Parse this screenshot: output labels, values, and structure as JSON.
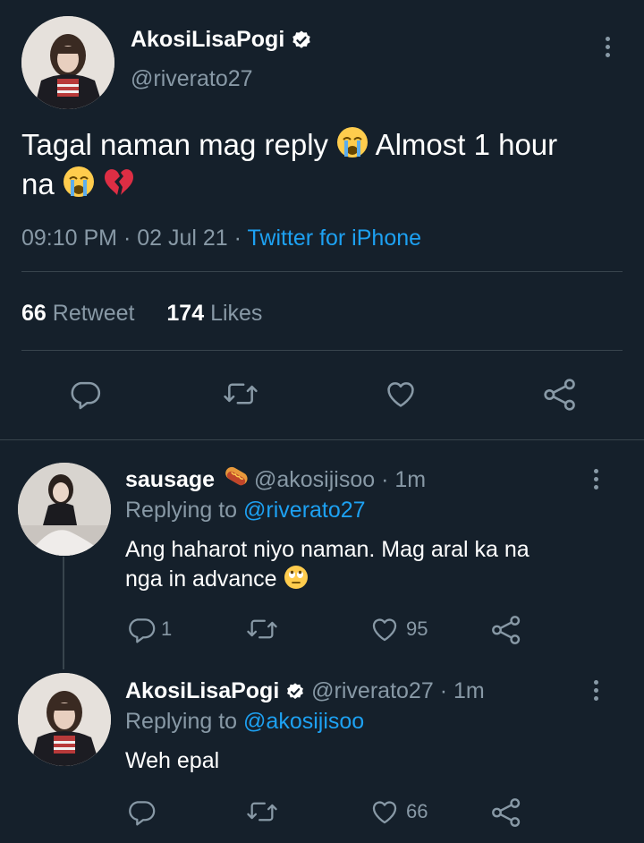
{
  "main_tweet": {
    "display_name": "AkosiLisaPogi",
    "handle": "@riverato27",
    "text_line1": "Tagal naman mag reply",
    "text_line1b": "Almost 1 hour",
    "text_line2": "na",
    "time": "09:10 PM",
    "date": "02 Jul 21",
    "source": "Twitter for iPhone",
    "retweet_count": "66",
    "retweet_label": "Retweet",
    "like_count": "174",
    "like_label": "Likes"
  },
  "replies": [
    {
      "display_name": "sausage",
      "handle": "@akosijisoo",
      "age": "· 1m",
      "replying_prefix": "Replying to",
      "replying_to": "@riverato27",
      "text_line1": "Ang haharot niyo naman. Mag aral ka na",
      "text_line2": "nga in advance",
      "reply_count": "1",
      "like_count": "95"
    },
    {
      "display_name": "AkosiLisaPogi",
      "handle": "@riverato27",
      "age": "· 1m",
      "replying_prefix": "Replying to",
      "replying_to": "@akosijisoo",
      "text_line1": "Weh epal",
      "reply_count": "",
      "like_count": "66"
    }
  ],
  "icons": {
    "reply": "reply-icon",
    "retweet": "retweet-icon",
    "like": "heart-icon",
    "share": "share-icon",
    "more": "more-vertical-icon",
    "verified": "verified-badge-icon"
  },
  "colors": {
    "background": "#15202b",
    "muted": "#8899a6",
    "link": "#1da1f2",
    "divider": "#38444d"
  }
}
